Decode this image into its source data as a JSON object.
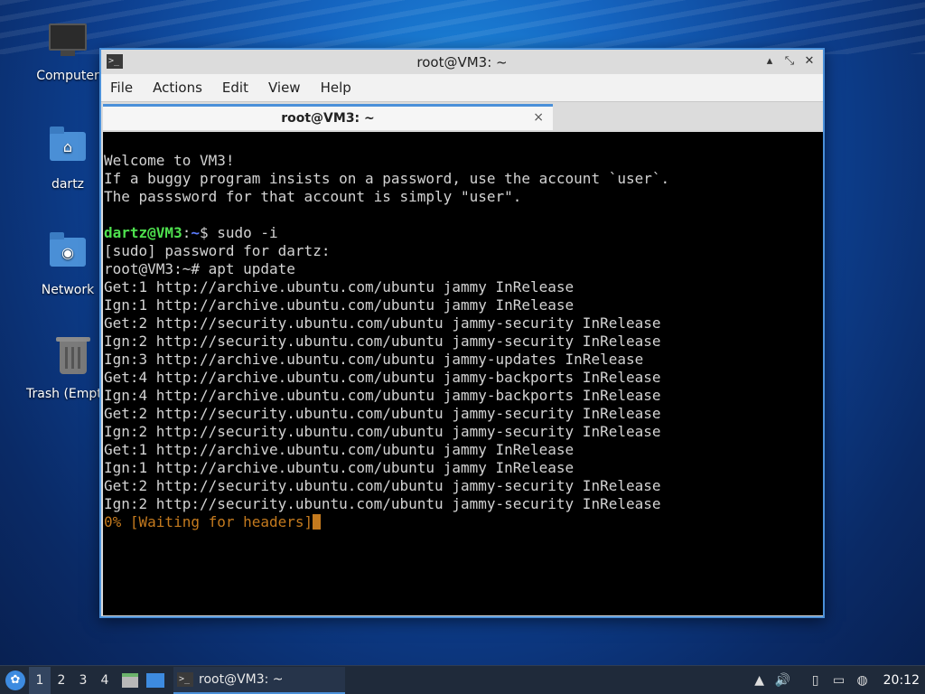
{
  "desktop": {
    "icons": [
      {
        "label": "Computer",
        "icon": "computer-icon"
      },
      {
        "label": "dartz",
        "icon": "home-folder-icon"
      },
      {
        "label": "Network",
        "icon": "network-folder-icon"
      },
      {
        "label": "Trash (Empty)",
        "icon": "trash-icon"
      }
    ]
  },
  "window": {
    "title": "root@VM3: ~",
    "menu": [
      "File",
      "Actions",
      "Edit",
      "View",
      "Help"
    ],
    "tab_label": "root@VM3: ~",
    "tab_close": "×",
    "buttons": {
      "minimize": "▴",
      "maximize": "⤡",
      "close": "✕"
    }
  },
  "terminal": {
    "welcome": [
      "Welcome to VM3!",
      "If a buggy program insists on a password, use the account `user`.",
      "The passsword for that account is simply \"user\"."
    ],
    "prompt_user": "dartz@VM3",
    "prompt_colon": ":",
    "prompt_path": "~",
    "prompt_cmd": "$ sudo -i",
    "output": [
      "[sudo] password for dartz:",
      "root@VM3:~# apt update",
      "Get:1 http://archive.ubuntu.com/ubuntu jammy InRelease",
      "Ign:1 http://archive.ubuntu.com/ubuntu jammy InRelease",
      "Get:2 http://security.ubuntu.com/ubuntu jammy-security InRelease",
      "Ign:2 http://security.ubuntu.com/ubuntu jammy-security InRelease",
      "Ign:3 http://archive.ubuntu.com/ubuntu jammy-updates InRelease",
      "Get:4 http://archive.ubuntu.com/ubuntu jammy-backports InRelease",
      "Ign:4 http://archive.ubuntu.com/ubuntu jammy-backports InRelease",
      "Get:2 http://security.ubuntu.com/ubuntu jammy-security InRelease",
      "Ign:2 http://security.ubuntu.com/ubuntu jammy-security InRelease",
      "Get:1 http://archive.ubuntu.com/ubuntu jammy InRelease",
      "Ign:1 http://archive.ubuntu.com/ubuntu jammy InRelease",
      "Get:2 http://security.ubuntu.com/ubuntu jammy-security InRelease",
      "Ign:2 http://security.ubuntu.com/ubuntu jammy-security InRelease"
    ],
    "progress": "0% [Waiting for headers]"
  },
  "taskbar": {
    "workspaces": [
      "1",
      "2",
      "3",
      "4"
    ],
    "active_workspace": "1",
    "task_label": "root@VM3: ~",
    "clock": "20:12",
    "colors": {
      "accent": "#4a90d9",
      "panel": "#1f2a3a"
    }
  }
}
